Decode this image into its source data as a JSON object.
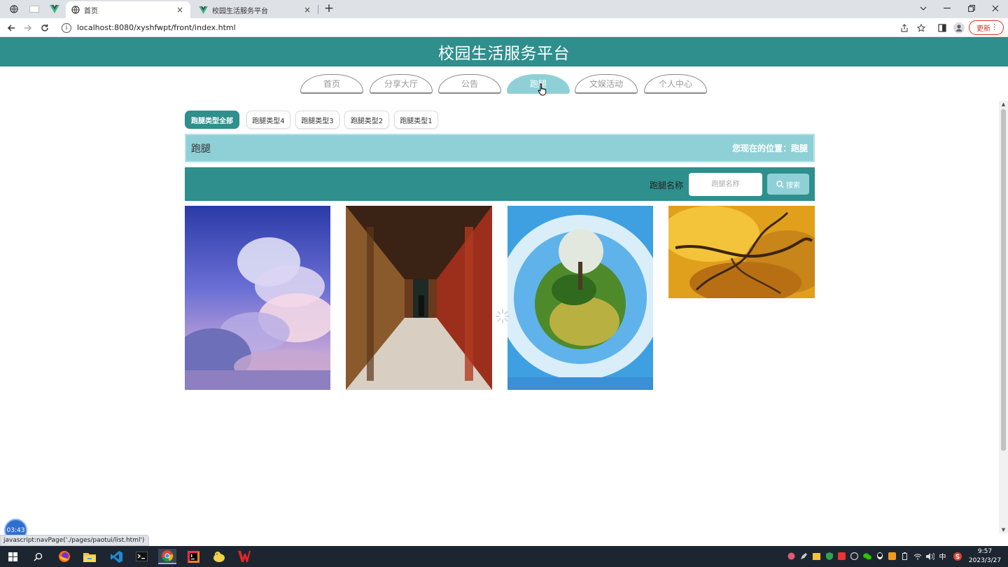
{
  "browser": {
    "tabs": [
      {
        "title": "首页",
        "active": true
      },
      {
        "title": "校园生活服务平台",
        "active": false
      }
    ],
    "close_glyph": "×",
    "new_tab_glyph": "+",
    "url": "localhost:8080/xyshfwpt/front/index.html",
    "update_label": "更新",
    "status_url": "javascript:navPage('./pages/paotui/list.html')"
  },
  "site": {
    "title": "校园生活服务平台"
  },
  "nav": {
    "items": [
      "首页",
      "分享大厅",
      "公告",
      "跑腿",
      "文娱活动",
      "个人中心"
    ],
    "active": "跑腿"
  },
  "categories": {
    "items": [
      "跑腿类型全部",
      "跑腿类型4",
      "跑腿类型3",
      "跑腿类型2",
      "跑腿类型1"
    ],
    "active": "跑腿类型全部"
  },
  "breadcrumb": {
    "title": "跑腿",
    "location": "您现在的位置：跑腿"
  },
  "search": {
    "label": "跑腿名称",
    "placeholder": "跑腿名称",
    "button_label": "搜索"
  },
  "cards": [
    {
      "image": "anime-sky-clouds"
    },
    {
      "image": "red-pillar-corridor"
    },
    {
      "image": "tiny-planet-landscape"
    },
    {
      "image": "golden-autumn-tree"
    }
  ],
  "overlay": {
    "timer": "03:43"
  },
  "taskbar": {
    "apps": [
      "windows-start-icon",
      "search-icon",
      "firefox-icon",
      "file-explorer-icon",
      "vscode-icon",
      "terminal-icon",
      "chrome-icon",
      "intellij-icon",
      "app-icon",
      "wps-icon"
    ],
    "active_app": "chrome-icon",
    "ime": "中",
    "time": "9:57",
    "date": "2023/3/27"
  },
  "colors": {
    "primary": "#2e8f8c",
    "secondary": "#8fd0d7"
  }
}
